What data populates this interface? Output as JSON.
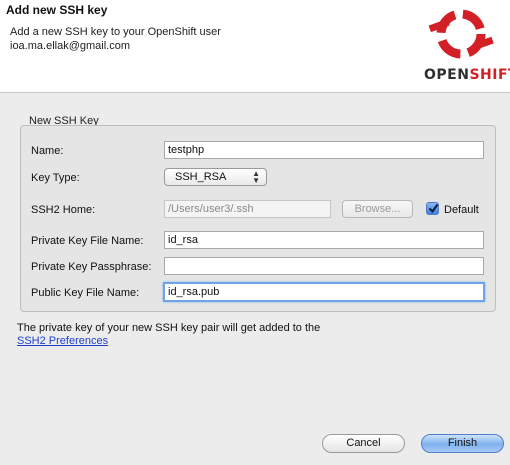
{
  "header": {
    "title": "Add new SSH key",
    "description_line1": "Add a new SSH key to your OpenShift user",
    "description_line2": "ioa.ma.ellak@gmail.com",
    "logo_text_open": "OPEN",
    "logo_text_shift": "SHIFT",
    "logo_color": "#d31f26"
  },
  "form": {
    "group_title": "New SSH Key",
    "name_label": "Name:",
    "name_value": "testphp",
    "key_type_label": "Key Type:",
    "key_type_value": "SSH_RSA",
    "ssh2_home_label": "SSH2 Home:",
    "ssh2_home_value": "/Users/user3/.ssh",
    "browse_label": "Browse...",
    "default_label": "Default",
    "private_key_label": "Private Key File Name:",
    "private_key_value": "id_rsa",
    "passphrase_label": "Private Key Passphrase:",
    "passphrase_value": "",
    "public_key_label": "Public Key File Name:",
    "public_key_value": "id_rsa.pub"
  },
  "note": {
    "text": "The private key of your new SSH key pair will get added to the",
    "link": "SSH2 Preferences"
  },
  "buttons": {
    "cancel": "Cancel",
    "finish": "Finish"
  }
}
